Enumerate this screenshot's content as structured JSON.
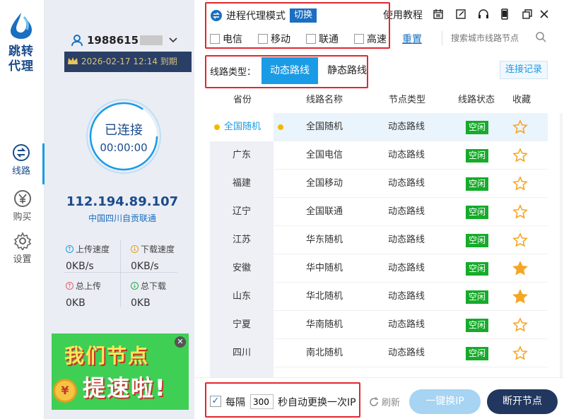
{
  "app": {
    "logo_text_line1": "跳转",
    "logo_text_line2": "代理"
  },
  "nav": [
    {
      "label": "线路",
      "icon": "route-icon",
      "active": true
    },
    {
      "label": "购买",
      "icon": "yen-icon",
      "active": false
    },
    {
      "label": "设置",
      "icon": "gear-icon",
      "active": false
    }
  ],
  "account": {
    "user": "1988615",
    "expiry": "2026-02-17 12:14 到期",
    "status": "已连接",
    "timer": "00:00:00",
    "ip": "112.194.89.107",
    "location": "中国四川自贡联通",
    "upload_speed_label": "上传速度",
    "upload_speed": "0KB/s",
    "download_speed_label": "下载速度",
    "download_speed": "0KB/s",
    "total_upload_label": "总上传",
    "total_upload": "0KB",
    "total_download_label": "总下载",
    "total_download": "0KB"
  },
  "ad": {
    "line1": "我们节点",
    "line2": "提速啦!",
    "coin": "¥"
  },
  "header": {
    "mode_label": "进程代理模式",
    "switch_label": "切换",
    "tutorial": "使用教程",
    "carriers": [
      "电信",
      "移动",
      "联通",
      "高速"
    ],
    "reset": "重置",
    "search_placeholder": "搜索城市线路节点"
  },
  "line_type": {
    "label": "线路类型：",
    "tabs": [
      "动态路线",
      "静态路线"
    ],
    "record": "连接记录"
  },
  "table": {
    "headers": [
      "省份",
      "线路名称",
      "节点类型",
      "线路状态",
      "收藏"
    ],
    "provinces": [
      "全国随机",
      "广东",
      "福建",
      "辽宁",
      "江苏",
      "安徽",
      "山东",
      "宁夏",
      "四川"
    ],
    "rows": [
      {
        "name": "全国随机",
        "type": "动态路线",
        "status": "空闲",
        "fav": false
      },
      {
        "name": "全国电信",
        "type": "动态路线",
        "status": "空闲",
        "fav": false
      },
      {
        "name": "全国移动",
        "type": "动态路线",
        "status": "空闲",
        "fav": false
      },
      {
        "name": "全国联通",
        "type": "动态路线",
        "status": "空闲",
        "fav": false
      },
      {
        "name": "华东随机",
        "type": "动态路线",
        "status": "空闲",
        "fav": false
      },
      {
        "name": "华中随机",
        "type": "动态路线",
        "status": "空闲",
        "fav": true
      },
      {
        "name": "华北随机",
        "type": "动态路线",
        "status": "空闲",
        "fav": true
      },
      {
        "name": "华南随机",
        "type": "动态路线",
        "status": "空闲",
        "fav": false
      },
      {
        "name": "南北随机",
        "type": "动态路线",
        "status": "空闲",
        "fav": false
      }
    ]
  },
  "footer": {
    "every": "每隔",
    "interval": "300",
    "suffix": "秒自动更换一次IP",
    "refresh": "刷新",
    "change_ip": "一键换IP",
    "disconnect": "断开节点"
  },
  "colors": {
    "accent": "#1a9be6",
    "navy": "#21375f",
    "idle": "#16ab2a",
    "star": "#f5a623",
    "highlight": "#e0282e"
  }
}
